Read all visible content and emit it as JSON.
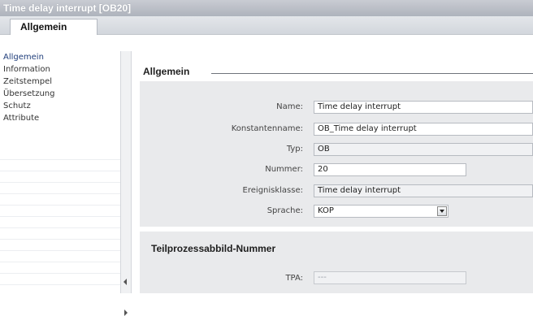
{
  "window": {
    "title": "Time delay interrupt [OB20]"
  },
  "tabs": [
    {
      "label": "Allgemein"
    }
  ],
  "nav": {
    "items": [
      {
        "label": "Allgemein",
        "active": true
      },
      {
        "label": "Information"
      },
      {
        "label": "Zeitstempel"
      },
      {
        "label": "Übersetzung"
      },
      {
        "label": "Schutz"
      },
      {
        "label": "Attribute"
      }
    ]
  },
  "general": {
    "title": "Allgemein",
    "fields": {
      "name": {
        "label": "Name:",
        "value": "Time delay interrupt"
      },
      "constant_name": {
        "label": "Konstantenname:",
        "value": "OB_Time delay interrupt"
      },
      "type": {
        "label": "Typ:",
        "value": "OB"
      },
      "number": {
        "label": "Nummer:",
        "value": "20"
      },
      "event_class": {
        "label": "Ereignisklasse:",
        "value": "Time delay interrupt"
      },
      "language": {
        "label": "Sprache:",
        "value": "KOP"
      }
    }
  },
  "process_image": {
    "title": "Teilprozessabbild-Nummer",
    "tpa": {
      "label": "TPA:",
      "value": "---"
    }
  },
  "colors": {
    "panel": "#e9eaec",
    "title_bar": "#aeb3bc",
    "nav_active": "#1f3d7a"
  }
}
